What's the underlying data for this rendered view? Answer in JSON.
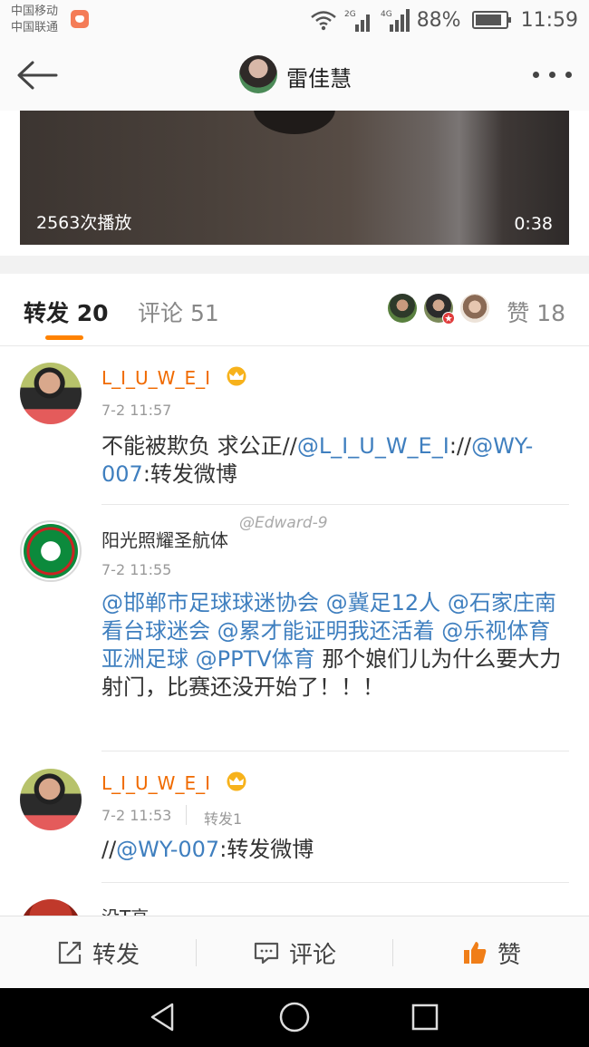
{
  "status_bar": {
    "carrier1": "中国移动",
    "carrier2": "中国联通",
    "net1": "2G",
    "net2": "4G",
    "battery": "88%",
    "time": "11:59"
  },
  "nav": {
    "title": "雷佳慧"
  },
  "video": {
    "plays": "2563次播放",
    "duration": "0:38"
  },
  "tabs": {
    "repost_label": "转发",
    "repost_count": "20",
    "comment_label": "评论",
    "comment_count": "51",
    "like_label": "赞",
    "like_count": "18"
  },
  "reposts": [
    {
      "name": "L_I_U_W_E_I",
      "time": "7-2 11:57",
      "t1": "不能被欺负 求公正//",
      "m1": "@L_I_U_W_E_I",
      "t2": "://",
      "m2": "@WY-007",
      "t3": ":转发微博"
    },
    {
      "name": "阳光照耀圣航体",
      "time": "7-2 11:55",
      "m1": "@邯郸市足球球迷协会",
      "m2": "@冀足12人",
      "m3": "@石家庄南看台球迷会",
      "m4": "@累才能证明我还活着",
      "m5": "@乐视体育亚洲足球",
      "m6": "@PPTV体育",
      "t1": "那个娘们儿为什么要大力射门，比赛还没开始了！！！"
    },
    {
      "name": "L_I_U_W_E_I",
      "time": "7-2 11:53",
      "repost_count": "转发1",
      "t1": "//",
      "m1": "@WY-007",
      "t2": ":转发微博"
    },
    {
      "name": "没T高"
    }
  ],
  "watermark": "@Edward-9",
  "actions": {
    "repost": "转发",
    "comment": "评论",
    "like": "赞"
  },
  "colors": {
    "accent": "#ff8200",
    "mention": "#3f7fbf",
    "vip_name": "#f06a00"
  },
  "icons": [
    "back-icon",
    "more-icon",
    "crown-icon",
    "repost-icon",
    "comment-icon",
    "thumbs-up-icon",
    "nav-back-icon",
    "nav-home-icon",
    "nav-recent-icon"
  ]
}
